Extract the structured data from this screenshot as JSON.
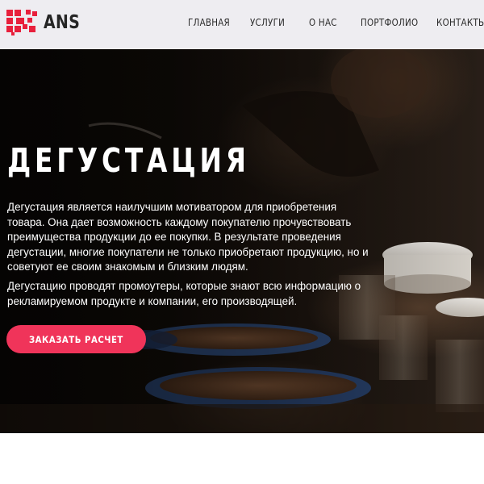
{
  "header": {
    "logo_text": "ANS",
    "nav": [
      "ГЛАВНАЯ",
      "УСЛУГИ",
      "О НАС",
      "ПОРТФОЛИО",
      "КОНТАКТЫ"
    ]
  },
  "hero": {
    "title": "ДЕГУСТАЦИЯ",
    "paragraph1": "Дегустация является наилучшим мотиватором для приобретения товара. Она дает возможность каждому покупателю прочувствовать преимущества продукции до ее покупки. В результате проведения дегустации, многие покупатели не только приобретают продукцию, но и советуют ее своим знакомым и близким людям.",
    "paragraph2": "Дегустацию проводят промоутеры, которые знают всю информацию о рекламируемом продукте и компании, его производящей.",
    "cta_label": "ЗАКАЗАТЬ РАСЧЕТ"
  },
  "colors": {
    "accent": "#f0345a",
    "logo_red": "#e8203c",
    "header_bg": "#eeedf1"
  }
}
